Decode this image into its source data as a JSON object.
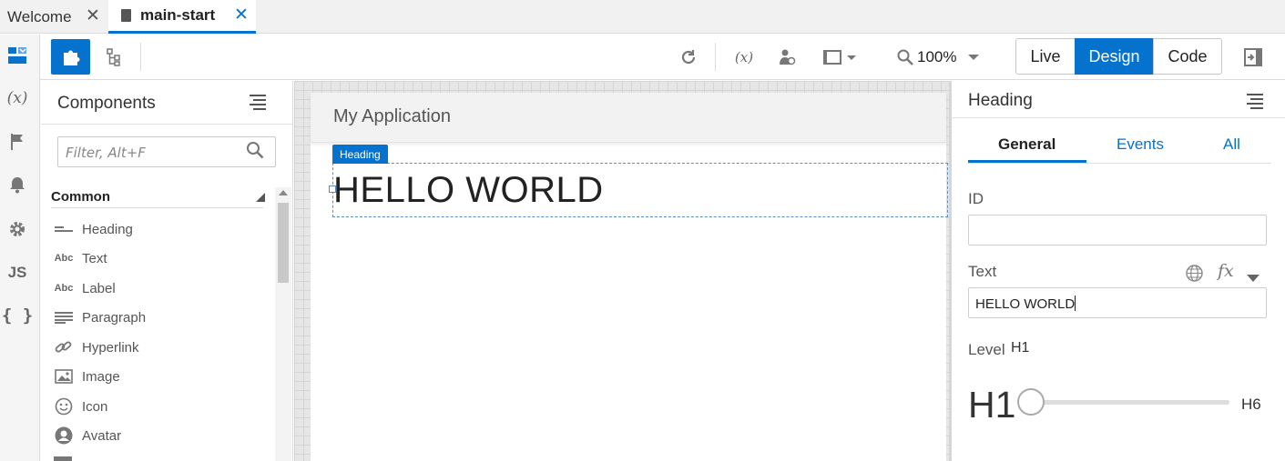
{
  "tabs": [
    {
      "label": "Welcome"
    },
    {
      "label": "main-start"
    }
  ],
  "rail": {
    "vars_label": "(x)",
    "js_label": "JS",
    "json_label": "{ }"
  },
  "toolbar": {
    "fx_label": "(x)",
    "zoom": "100%",
    "modes": [
      "Live",
      "Design",
      "Code"
    ],
    "active_mode": "Design"
  },
  "components": {
    "title": "Components",
    "filter_placeholder": "Filter, Alt+F",
    "section": "Common",
    "items": [
      {
        "label": "Heading",
        "icon": "heading-icon"
      },
      {
        "label": "Text",
        "icon": "text-icon"
      },
      {
        "label": "Label",
        "icon": "label-icon"
      },
      {
        "label": "Paragraph",
        "icon": "paragraph-icon"
      },
      {
        "label": "Hyperlink",
        "icon": "link-icon"
      },
      {
        "label": "Image",
        "icon": "image-icon"
      },
      {
        "label": "Icon",
        "icon": "icon-icon"
      },
      {
        "label": "Avatar",
        "icon": "avatar-icon"
      }
    ],
    "abc": "Abc"
  },
  "canvas": {
    "app_title": "My Application",
    "selected_badge": "Heading",
    "heading_text": "HELLO WORLD"
  },
  "properties": {
    "title": "Heading",
    "tabs": [
      "General",
      "Events",
      "All"
    ],
    "active_tab": "General",
    "id_label": "ID",
    "id_value": "",
    "text_label": "Text",
    "text_value": "HELLO WORLD",
    "fx_label": "fx",
    "level_label": "Level",
    "level_value": "H1",
    "slider_min": "H1",
    "slider_max": "H6",
    "level_fraction": 0
  },
  "colors": {
    "accent": "#0572ce"
  }
}
